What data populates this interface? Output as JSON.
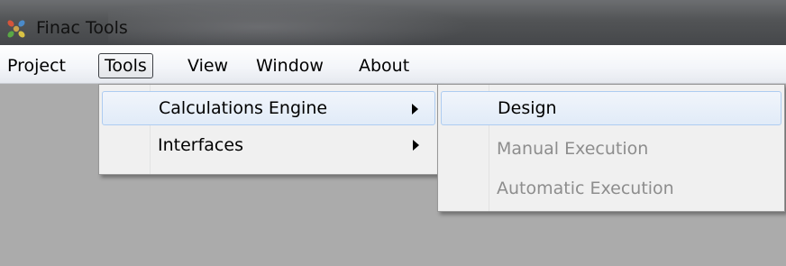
{
  "window": {
    "title": "Finac Tools",
    "icon": "app-logo-icon"
  },
  "menubar": {
    "items": [
      {
        "label": "Project"
      },
      {
        "label": "Tools",
        "open": true
      },
      {
        "label": "View"
      },
      {
        "label": "Window"
      },
      {
        "label": "About"
      }
    ]
  },
  "tools_menu": {
    "items": [
      {
        "label": "Calculations Engine",
        "submenu": true,
        "highlighted": true
      },
      {
        "label": "Interfaces",
        "submenu": true
      }
    ]
  },
  "calc_submenu": {
    "items": [
      {
        "label": "Design",
        "enabled": true,
        "highlighted": true
      },
      {
        "label": "Manual Execution",
        "enabled": false
      },
      {
        "label": "Automatic Execution",
        "enabled": false
      }
    ]
  },
  "colors": {
    "desktop": "#ababab",
    "highlight_border": "#aeccf1",
    "disabled_text": "#8d8d8d"
  }
}
